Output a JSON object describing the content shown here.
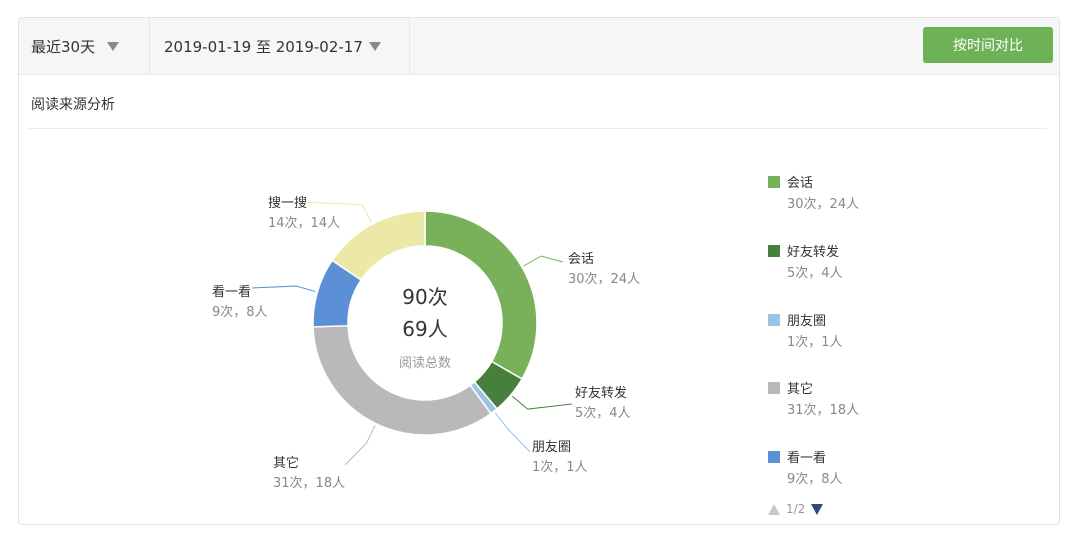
{
  "toolbar": {
    "range_label": "最近30天",
    "date_range": "2019-01-19 至 2019-02-17",
    "compare_button": "按时间对比"
  },
  "section_title": "阅读来源分析",
  "center": {
    "times": "90次",
    "people": "69人",
    "caption": "阅读总数"
  },
  "legend_pager": "1/2",
  "chart_data": {
    "type": "pie",
    "variant": "donut",
    "title": "",
    "series": [
      {
        "name": "会话",
        "times": 30,
        "people": 24,
        "label": "30次，24人",
        "color": "#78b159"
      },
      {
        "name": "好友转发",
        "times": 5,
        "people": 4,
        "label": "5次，4人",
        "color": "#47803d"
      },
      {
        "name": "朋友圈",
        "times": 1,
        "people": 1,
        "label": "1次，1人",
        "color": "#9cc3e4"
      },
      {
        "name": "其它",
        "times": 31,
        "people": 18,
        "label": "31次，18人",
        "color": "#b9b9b9"
      },
      {
        "name": "看一看",
        "times": 9,
        "people": 8,
        "label": "9次，8人",
        "color": "#5b8fd6"
      },
      {
        "name": "搜一搜",
        "times": 14,
        "people": 14,
        "label": "14次，14人",
        "color": "#ece9a8"
      }
    ],
    "legend_visible": [
      "会话",
      "好友转发",
      "朋友圈",
      "其它",
      "看一看"
    ],
    "legend_position": "right"
  }
}
